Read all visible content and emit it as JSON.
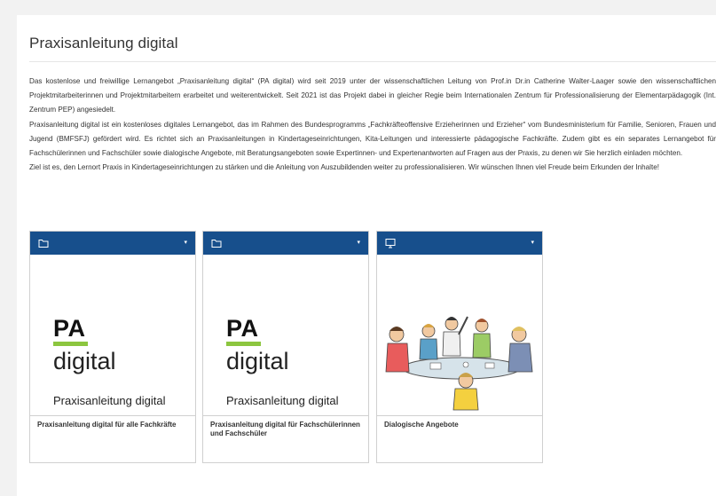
{
  "page": {
    "title": "Praxisanleitung digital",
    "paragraphs": [
      "Das kostenlose und freiwillige Lernangebot „Praxisanleitung digital“ (PA digital) wird seit 2019 unter der wissenschaftlichen Leitung von Prof.in Dr.in Catherine Walter-Laager sowie den wissenschaftlichen Projektmitarbeiterinnen und Projektmitarbeitern erarbeitet und weiterentwickelt. Seit 2021 ist das Projekt dabei in gleicher Regie beim Internationalen Zentrum für Professionalisierung der Elementarpädagogik (Int. Zentrum PEP) angesiedelt.",
      "Praxisanleitung digital ist ein kostenloses digitales Lernangebot, das im Rahmen des Bundesprogramms „Fachkräfteoffensive Erzieherinnen und Erzieher“ vom Bundesministerium für Familie, Senioren, Frauen und Jugend (BMFSFJ) gefördert wird. Es richtet sich an Praxisanleitungen in Kindertageseinrichtungen, Kita-Leitungen und interessierte pädagogische Fachkräfte. Zudem gibt es ein separates Lernangebot für Fachschülerinnen und Fachschüler sowie dialogische Angebote, mit Beratungsangeboten sowie Expertinnen- und Expertenantworten auf Fragen aus der Praxis, zu denen wir Sie herzlich einladen möchten.",
      "Ziel ist es, den Lernort Praxis in Kindertageseinrichtungen zu stärken und die Anleitung von Auszubildenden weiter zu professionalisieren. Wir wünschen Ihnen viel Freude beim Erkunden der Inhalte!"
    ]
  },
  "tiles": [
    {
      "icon": "folder-icon",
      "label": "Praxisanleitung digital für alle Fachkräfte",
      "logo": {
        "pa": "PA",
        "digital": "digital",
        "sub": "Praxisanleitung digital"
      }
    },
    {
      "icon": "folder-icon",
      "label": "Praxisanleitung digital für Fachschülerinnen und Fachschüler",
      "logo": {
        "pa": "PA",
        "digital": "digital",
        "sub": "Praxisanleitung digital"
      }
    },
    {
      "icon": "monitor-icon",
      "label": "Dialogische Angebote",
      "image": "group-discussion-cartoon"
    }
  ],
  "colors": {
    "tile_header": "#174f8c",
    "logo_accent": "#8cc63f",
    "background": "#f2f2f2"
  }
}
